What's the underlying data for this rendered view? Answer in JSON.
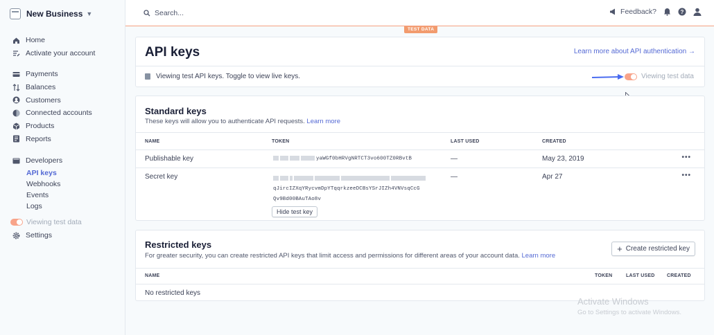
{
  "account": {
    "name": "New Business"
  },
  "search": {
    "placeholder": "Search..."
  },
  "topbar": {
    "feedback": "Feedback?",
    "test_badge": "TEST DATA"
  },
  "sidebar": {
    "items": [
      {
        "label": "Home",
        "icon": "home-icon"
      },
      {
        "label": "Activate your account",
        "icon": "activate-icon"
      },
      {
        "label": "Payments",
        "icon": "payments-icon"
      },
      {
        "label": "Balances",
        "icon": "balances-icon"
      },
      {
        "label": "Customers",
        "icon": "customers-icon"
      },
      {
        "label": "Connected accounts",
        "icon": "connected-icon"
      },
      {
        "label": "Products",
        "icon": "products-icon"
      },
      {
        "label": "Reports",
        "icon": "reports-icon"
      },
      {
        "label": "Developers",
        "icon": "developers-icon"
      }
    ],
    "developer_sub": [
      "API keys",
      "Webhooks",
      "Events",
      "Logs"
    ],
    "viewing_test_data": "Viewing test data",
    "settings": "Settings"
  },
  "header": {
    "title": "API keys",
    "learn_auth": "Learn more about API authentication →",
    "info": "Viewing test API keys. Toggle to view live keys.",
    "toggle_label": "Viewing test data"
  },
  "standard": {
    "title": "Standard keys",
    "desc": "These keys will allow you to authenticate API requests.",
    "learn_more": "Learn more",
    "columns": {
      "name": "NAME",
      "token": "TOKEN",
      "last_used": "LAST USED",
      "created": "CREATED"
    },
    "rows": [
      {
        "name": "Publishable key",
        "token_visible": "yaWGf0bHRVgNRTCT3vo600TZ0RBvtB",
        "last_used": "—",
        "created": "May 23, 2019"
      },
      {
        "name": "Secret key",
        "token_line2": "qJircIZXqYRycvmDpYTqqrkzeeDCBsYSrJIZh4VNVsqCcG",
        "token_line3": "Qv9Bd00BAuTAo8v",
        "last_used": "—",
        "created": "Apr 27"
      }
    ],
    "hide_button": "Hide test key"
  },
  "restricted": {
    "title": "Restricted keys",
    "desc": "For greater security, you can create restricted API keys that limit access and permissions for different areas of your account data.",
    "learn_more": "Learn more",
    "create_button": "Create restricted key",
    "columns": {
      "name": "NAME",
      "token": "TOKEN",
      "last_used": "LAST USED",
      "created": "CREATED"
    },
    "empty": "No restricted keys"
  },
  "watermark": {
    "title": "Activate Windows",
    "subtitle": "Go to Settings to activate Windows."
  },
  "colors": {
    "accent": "#5469d4",
    "test_orange": "#f29b6e",
    "arrow": "#4a6cf0"
  }
}
